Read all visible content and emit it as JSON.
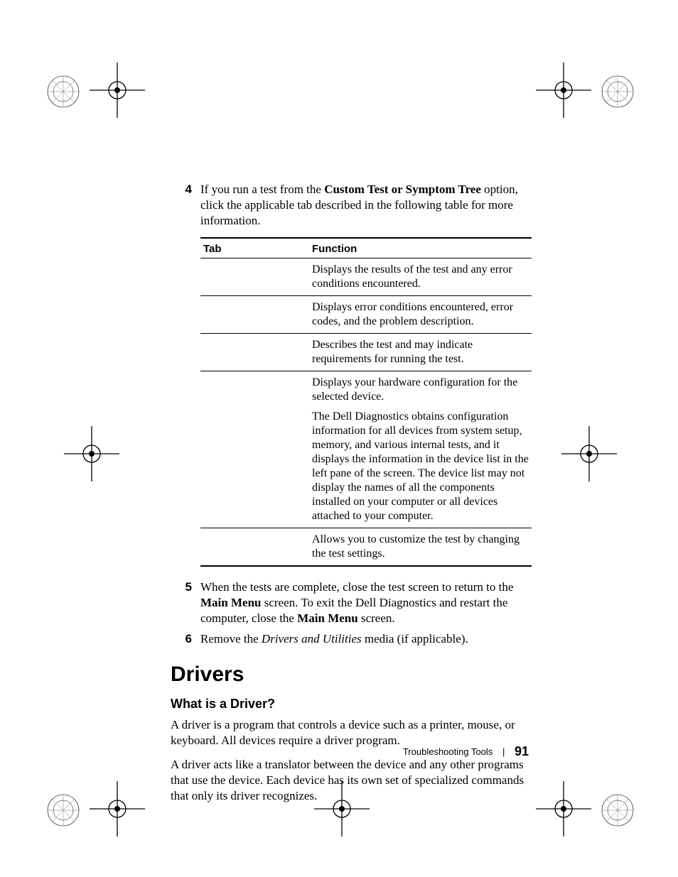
{
  "steps": {
    "s4": {
      "num": "4",
      "text_pre": "If you run a test from the ",
      "text_bold": "Custom Test or Symptom Tree",
      "text_post": " option, click the applicable tab described in the following table for more information."
    },
    "s5": {
      "num": "5",
      "text_a": "When the tests are complete, close the test screen to return to the ",
      "text_b_bold": "Main Menu",
      "text_c": " screen. To exit the Dell Diagnostics and restart the computer, close the ",
      "text_d_bold": "Main Menu",
      "text_e": " screen."
    },
    "s6": {
      "num": "6",
      "text_a": "Remove the ",
      "text_b_italic": "Drivers and Utilities",
      "text_c": " media (if applicable)."
    }
  },
  "table": {
    "headers": {
      "c1": "Tab",
      "c2": "Function"
    },
    "rows": [
      {
        "fn": "Displays the results of the test and any error conditions encountered."
      },
      {
        "fn": "Displays error conditions encountered, error codes, and the problem description."
      },
      {
        "fn": "Describes the test and may indicate requirements for running the test."
      },
      {
        "fn_p1": "Displays your hardware configuration for the selected device.",
        "fn_p2": "The Dell Diagnostics obtains configuration information for all devices from system setup, memory, and various internal tests, and it displays the information in the device list in the left pane of the screen. The device list may not display the names of all the components installed on your computer or all devices attached to your computer."
      },
      {
        "fn": "Allows you to customize the test by changing the test settings."
      }
    ]
  },
  "section": {
    "title": "Drivers",
    "sub": "What is a Driver?",
    "p1": "A driver is a program that controls a device such as a printer, mouse, or keyboard. All devices require a driver program.",
    "p2": "A driver acts like a translator between the device and any other programs that use the device. Each device has its own set of specialized commands that only its driver recognizes."
  },
  "footer": {
    "label": "Troubleshooting Tools",
    "sep": "|",
    "page": "91"
  }
}
